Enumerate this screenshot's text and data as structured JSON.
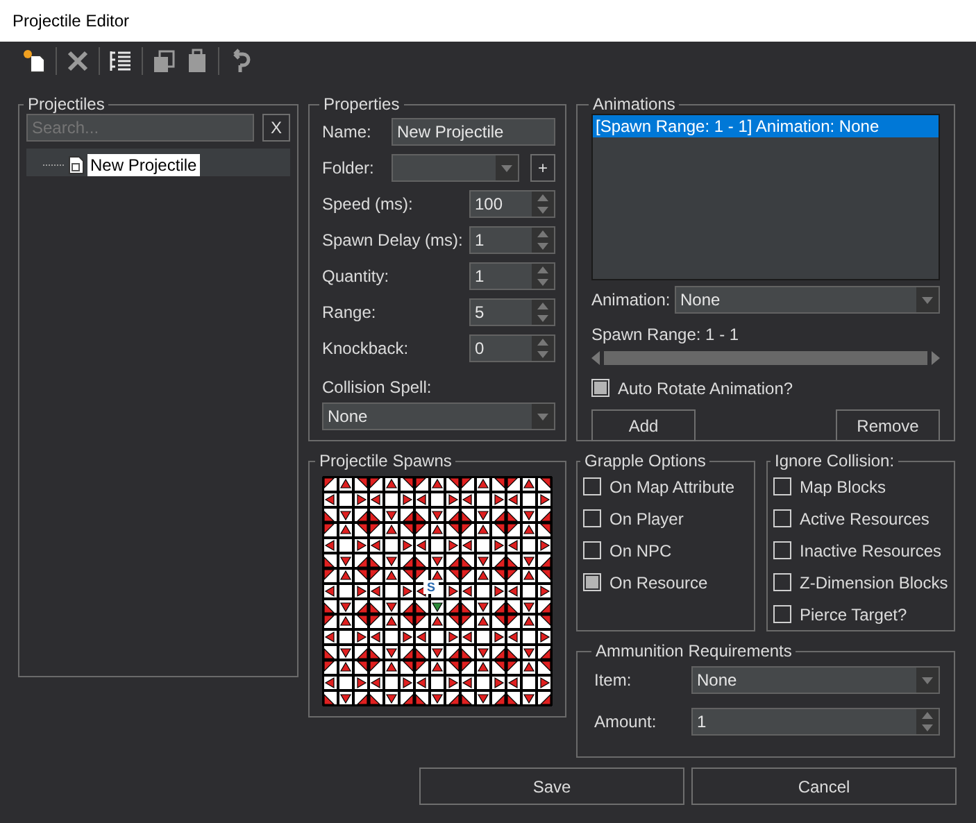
{
  "window": {
    "title": "Projectile Editor"
  },
  "toolbar": [
    {
      "kind": "new",
      "disabled": false
    },
    {
      "kind": "separator"
    },
    {
      "kind": "delete",
      "disabled": true
    },
    {
      "kind": "separator"
    },
    {
      "kind": "list",
      "disabled": false
    },
    {
      "kind": "separator"
    },
    {
      "kind": "copy",
      "disabled": true
    },
    {
      "kind": "paste",
      "disabled": true
    },
    {
      "kind": "separator"
    },
    {
      "kind": "undo",
      "disabled": true
    }
  ],
  "projectiles": {
    "title": "Projectiles",
    "search": {
      "placeholder": "Search..."
    },
    "clear_button": "X",
    "items": [
      {
        "label": "New Projectile",
        "selected": true
      }
    ]
  },
  "properties": {
    "title": "Properties",
    "fields": [
      {
        "kind": "text",
        "label": "Name:",
        "value": "New Projectile"
      },
      {
        "kind": "folder",
        "label": "Folder:",
        "add_button": "+"
      },
      {
        "kind": "spinner",
        "label": "Speed (ms):",
        "value": "100"
      },
      {
        "kind": "spinner",
        "label": "Spawn Delay (ms):",
        "value": "1"
      },
      {
        "kind": "spinner",
        "label": "Quantity:",
        "value": "1"
      },
      {
        "kind": "spinner",
        "label": "Range:",
        "value": "5"
      },
      {
        "kind": "spinner",
        "label": "Knockback:",
        "value": "0"
      },
      {
        "kind": "dropdown",
        "label": "Collision Spell:",
        "value": "None"
      }
    ]
  },
  "spawns": {
    "title": "Projectile Spawns",
    "center_label": "S",
    "below_center_highlighted": true
  },
  "animations": {
    "title": "Animations",
    "list": [
      {
        "label": "[Spawn Range: 1 - 1]  Animation: None",
        "selected": true
      }
    ],
    "animation_label": "Animation:",
    "animation_value": "None",
    "spawn_range": "Spawn Range: 1 - 1",
    "auto_rotate": {
      "label": "Auto Rotate Animation?",
      "checked": true
    },
    "buttons": [
      "Add",
      "Remove"
    ]
  },
  "grapple": {
    "title": "Grapple Options",
    "options": [
      {
        "label": "On Map Attribute",
        "checked": false
      },
      {
        "label": "On Player",
        "checked": false
      },
      {
        "label": "On NPC",
        "checked": false
      },
      {
        "label": "On Resource",
        "checked": true
      }
    ]
  },
  "ignore_collision": {
    "title": "Ignore Collision:",
    "options": [
      {
        "label": "Map Blocks",
        "checked": false
      },
      {
        "label": "Active Resources",
        "checked": false
      },
      {
        "label": "Inactive Resources",
        "checked": false
      },
      {
        "label": "Z-Dimension Blocks",
        "checked": false
      },
      {
        "label": "Pierce Target?",
        "checked": false
      }
    ]
  },
  "ammunition": {
    "title": "Ammunition Requirements",
    "item_label": "Item:",
    "item_value": "None",
    "amount_label": "Amount:",
    "amount_value": "1"
  },
  "buttons": [
    "Save",
    "Cancel"
  ]
}
